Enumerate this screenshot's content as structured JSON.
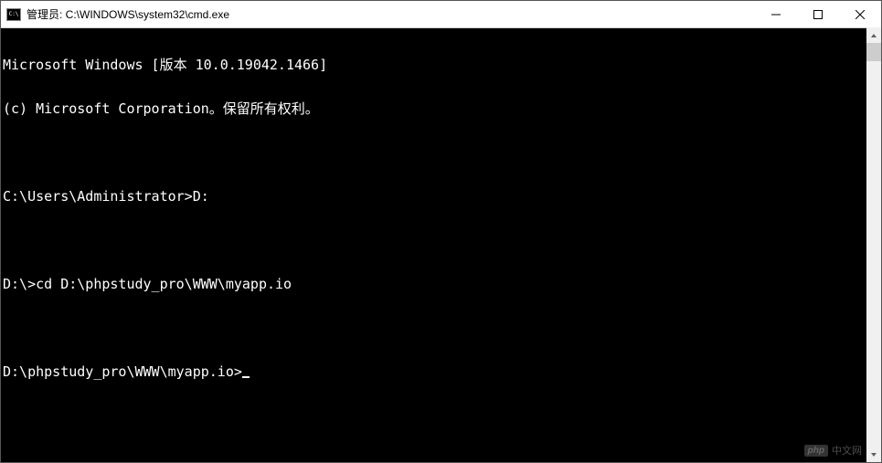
{
  "titlebar": {
    "title": "管理员: C:\\WINDOWS\\system32\\cmd.exe"
  },
  "terminal": {
    "line1": "Microsoft Windows [版本 10.0.19042.1466]",
    "line2": "(c) Microsoft Corporation。保留所有权利。",
    "line3": "",
    "line4_prompt": "C:\\Users\\Administrator>",
    "line4_cmd": "D:",
    "line5": "",
    "line6_prompt": "D:\\>",
    "line6_cmd": "cd D:\\phpstudy_pro\\WWW\\myapp.io",
    "line7": "",
    "line8_prompt": "D:\\phpstudy_pro\\WWW\\myapp.io>",
    "line8_cmd": ""
  },
  "watermark": {
    "logo": "php",
    "text": "中文网"
  }
}
